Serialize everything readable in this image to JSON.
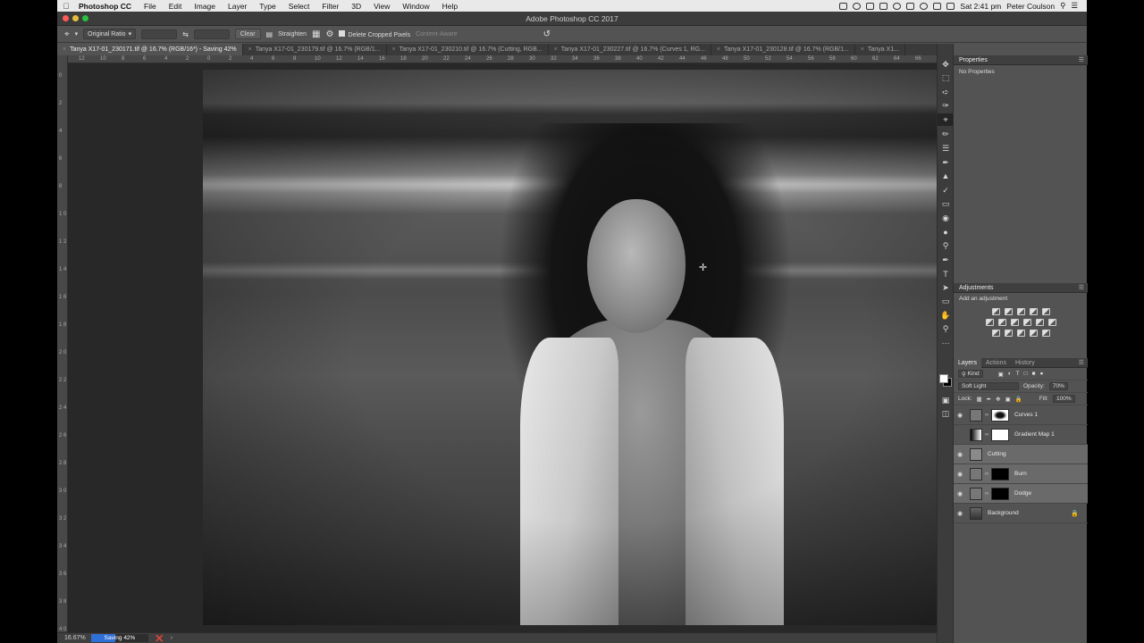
{
  "menubar": {
    "app_name": "Photoshop CC",
    "items": [
      "File",
      "Edit",
      "Image",
      "Layer",
      "Type",
      "Select",
      "Filter",
      "3D",
      "View",
      "Window",
      "Help"
    ],
    "clock": "Sat 2:41 pm",
    "user": "Peter Coulson"
  },
  "window": {
    "title": "Adobe Photoshop CC 2017"
  },
  "options": {
    "ratio": "Original Ratio",
    "clear": "Clear",
    "straighten": "Straighten",
    "delete_cropped": "Delete Cropped Pixels",
    "content_aware": "Content-Aware"
  },
  "tabs": [
    "Tanya X17-01_230171.tif @ 16.7% (RGB/16*) - Saving 42%",
    "Tanya X17-01_230179.tif @ 16.7% (RGB/1...",
    "Tanya X17-01_230210.tif @ 16.7% (Cutting, RGB...",
    "Tanya X17-01_230227.tif @ 16.7% (Curves 1, RG...",
    "Tanya X17-01_230128.tif @ 16.7% (RGB/1...",
    "Tanya X1..."
  ],
  "ruler_h": [
    "12",
    "10",
    "8",
    "6",
    "4",
    "2",
    "0",
    "2",
    "4",
    "6",
    "8",
    "10",
    "12",
    "14",
    "16",
    "18",
    "20",
    "22",
    "24",
    "26",
    "28",
    "30",
    "32",
    "34",
    "36",
    "38",
    "40",
    "42",
    "44",
    "46",
    "48",
    "50",
    "52",
    "54",
    "56",
    "58",
    "60",
    "62",
    "64",
    "66"
  ],
  "ruler_v": [
    "0",
    "2",
    "4",
    "6",
    "8",
    "1 0",
    "1 2",
    "1 4",
    "1 6",
    "1 8",
    "2 0",
    "2 2",
    "2 4",
    "2 6",
    "2 8",
    "3 0",
    "3 2",
    "3 4",
    "3 6",
    "3 8",
    "4 0"
  ],
  "status": {
    "zoom": "16.67%",
    "progress_label": "Saving 42%",
    "progress_fraction": 0.42
  },
  "properties": {
    "header": "Properties",
    "body": "No Properties"
  },
  "adjustments": {
    "header": "Adjustments",
    "sub": "Add an adjustment"
  },
  "layers_panel": {
    "tabs": [
      "Layers",
      "Actions",
      "History"
    ],
    "kind": "Kind",
    "blend_mode": "Soft Light",
    "opacity_label": "Opacity:",
    "opacity": "70%",
    "lock_label": "Lock:",
    "fill_label": "Fill:",
    "fill": "100%",
    "layers": [
      {
        "name": "Curves 1",
        "visible": true
      },
      {
        "name": "Gradient Map 1",
        "visible": false
      },
      {
        "name": "Cutting",
        "visible": true
      },
      {
        "name": "Burn",
        "visible": true
      },
      {
        "name": "Dodge",
        "visible": true
      },
      {
        "name": "Background",
        "visible": true
      }
    ]
  },
  "colors": {
    "progress_blue": "#2f6fd8",
    "panel_bg": "#535353",
    "canvas_bg": "#282828"
  }
}
